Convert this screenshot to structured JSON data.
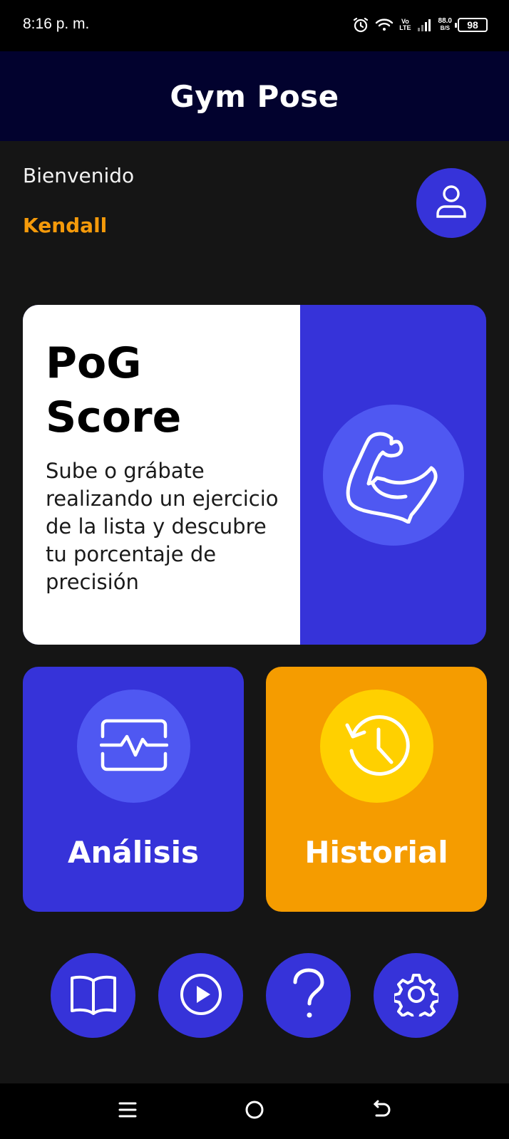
{
  "status_bar": {
    "time": "8:16 p. m.",
    "network_top": "Vo",
    "network_bottom": "LTE",
    "speed_value": "88.0",
    "speed_unit": "B/S",
    "battery": "98"
  },
  "header": {
    "title": "Gym Pose"
  },
  "greeting": {
    "welcome": "Bienvenido",
    "username": "Kendall"
  },
  "pog_card": {
    "title": "PoG Score",
    "description": "Sube o grábate realizando un ejercicio de la lista y descubre tu porcentaje de precisión",
    "icon": "flexed-bicep-icon"
  },
  "tiles": {
    "analisis": {
      "label": "Análisis",
      "icon": "activity-monitor-icon"
    },
    "historial": {
      "label": "Historial",
      "icon": "history-clock-icon"
    }
  },
  "bottom_buttons": [
    {
      "icon": "book-icon"
    },
    {
      "icon": "play-icon"
    },
    {
      "icon": "help-icon"
    },
    {
      "icon": "settings-icon"
    }
  ],
  "system_nav": [
    "menu-icon",
    "home-icon",
    "back-icon"
  ],
  "colors": {
    "header_bg": "#02022e",
    "primary_blue": "#3633d9",
    "accent_orange": "#f59c00",
    "username_orange": "#f59a0a",
    "icon_circle_blue": "#4f58f2",
    "icon_circle_yellow": "#ffd000",
    "background": "#151515"
  }
}
